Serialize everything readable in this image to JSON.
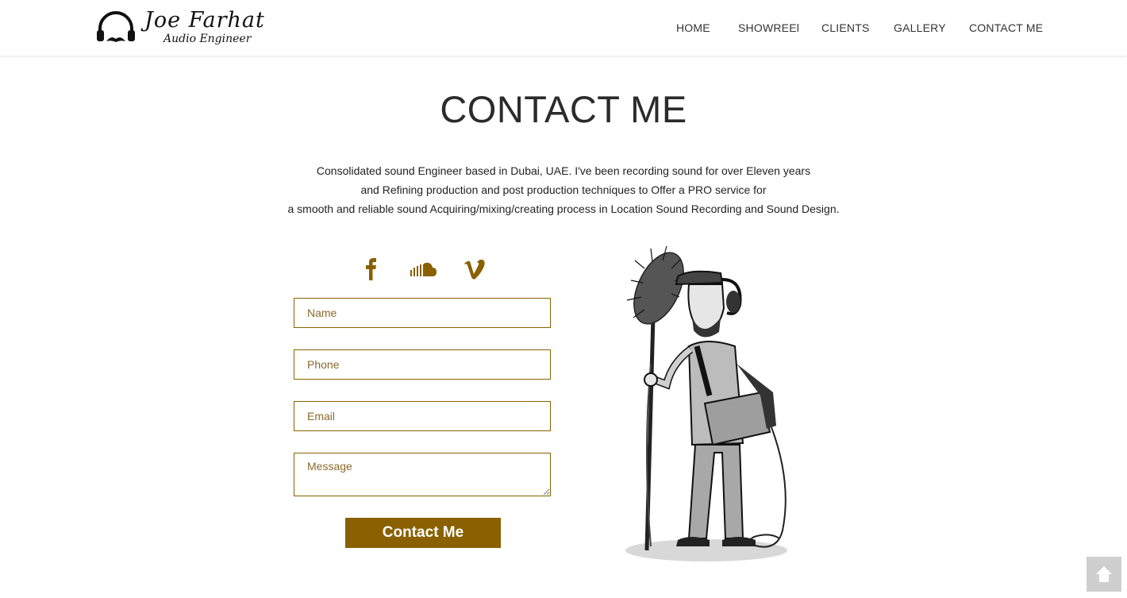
{
  "logo": {
    "name": "Joe Farhat",
    "subtitle": "Audio Engineer"
  },
  "nav": {
    "items": [
      {
        "label": "HOME"
      },
      {
        "label": "SHOWREEl"
      },
      {
        "label": "CLIENTS"
      },
      {
        "label": "GALLERY"
      },
      {
        "label": "CONTACT ME"
      }
    ]
  },
  "page": {
    "title": "CONTACT ME",
    "intro": [
      "Consolidated sound Engineer based in Dubai, UAE. I've been recording sound for over Eleven years",
      "and Refining production and post production techniques to Offer a PRO service for",
      "a smooth and reliable sound Acquiring/mixing/creating process in Location Sound Recording and Sound Design."
    ]
  },
  "social": [
    "facebook-icon",
    "soundcloud-icon",
    "vimeo-icon"
  ],
  "form": {
    "name_placeholder": "Name",
    "phone_placeholder": "Phone",
    "email_placeholder": "Email",
    "message_placeholder": "Message",
    "submit_label": "Contact Me"
  },
  "colors": {
    "accent": "#8a6000",
    "field_border": "#8a6300",
    "to_top_bg": "#cfcfcf"
  }
}
